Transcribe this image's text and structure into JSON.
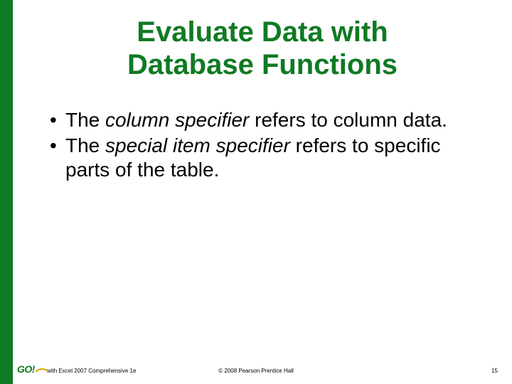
{
  "title_line1": "Evaluate Data with",
  "title_line2": "Database Functions",
  "bullets": [
    {
      "pre": "The ",
      "em": "column specifier",
      "post": " refers to column data."
    },
    {
      "pre": "The ",
      "em": "special item specifier",
      "post": " refers to specific parts of the table."
    }
  ],
  "logo_text": "GO!",
  "footer_left": "with Excel 2007 Comprehensive 1e",
  "footer_center": "© 2008 Pearson Prentice Hall",
  "footer_right": "15",
  "accent_color": "#0f7a23"
}
